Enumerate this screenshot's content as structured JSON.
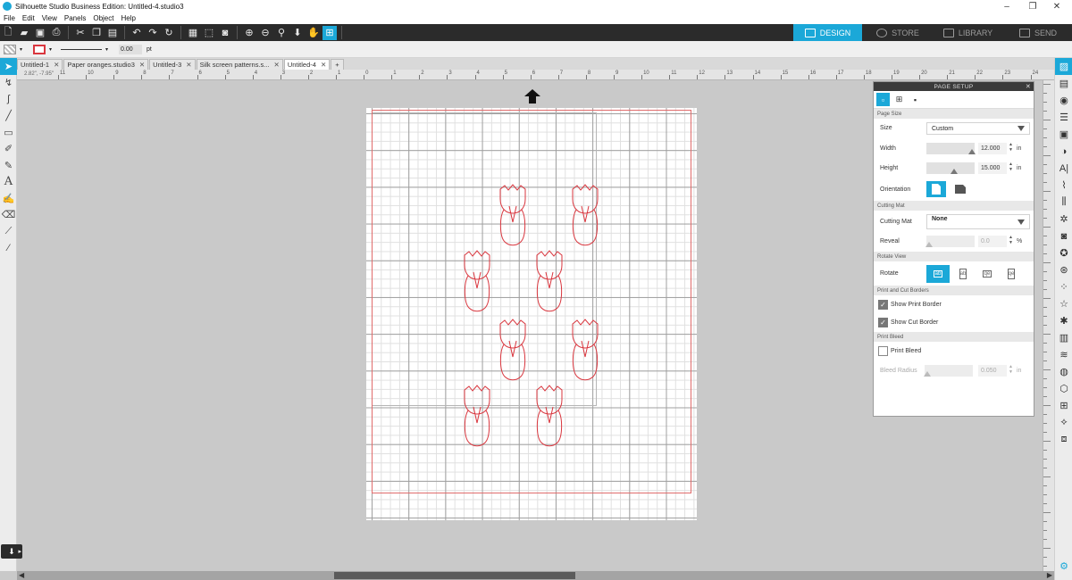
{
  "window": {
    "title": "Silhouette Studio Business Edition: Untitled-4.studio3",
    "minimize": "–",
    "maximize": "❐",
    "close": "✕"
  },
  "menu": [
    "File",
    "Edit",
    "View",
    "Panels",
    "Object",
    "Help"
  ],
  "nav_tabs": {
    "design": "DESIGN",
    "store": "STORE",
    "library": "LIBRARY",
    "send": "SEND"
  },
  "style_bar": {
    "line_width_value": "0.00",
    "line_width_unit": "pt"
  },
  "doc_tabs": [
    {
      "label": "Untitled-1",
      "active": false
    },
    {
      "label": "Paper oranges.studio3",
      "active": false
    },
    {
      "label": "Untitled-3",
      "active": false
    },
    {
      "label": "Silk screen patterns.s...",
      "active": false
    },
    {
      "label": "Untitled-4",
      "active": true
    }
  ],
  "add_tab": "+",
  "ruler": {
    "coord": "2.82\", -7.95\"",
    "labels": [
      "11",
      "10",
      "9",
      "8",
      "7",
      "6",
      "5",
      "4",
      "3",
      "2",
      "1",
      "0",
      "1",
      "2",
      "3",
      "4",
      "5",
      "6",
      "7",
      "8",
      "9",
      "10",
      "11",
      "12",
      "13",
      "14",
      "15",
      "16",
      "17",
      "18",
      "19",
      "20",
      "21",
      "22",
      "23",
      "24"
    ]
  },
  "page_setup": {
    "title": "PAGE SETUP",
    "sections": {
      "page_size": "Page Size",
      "cutting_mat": "Cutting Mat",
      "rotate_view": "Rotate View",
      "print_cut_borders": "Print and Cut Borders",
      "print_bleed": "Print Bleed"
    },
    "size_label": "Size",
    "size_value": "Custom",
    "width_label": "Width",
    "width_value": "12.000",
    "width_unit": "in",
    "height_label": "Height",
    "height_value": "15.000",
    "height_unit": "in",
    "orientation_label": "Orientation",
    "cutting_mat_label": "Cutting Mat",
    "cutting_mat_value": "None",
    "reveal_label": "Reveal",
    "reveal_value": "0.0",
    "reveal_unit": "%",
    "rotate_label": "Rotate",
    "show_print_border_label": "Show Print Border",
    "show_print_border_checked": true,
    "show_cut_border_label": "Show Cut Border",
    "show_cut_border_checked": true,
    "print_bleed_label": "Print Bleed",
    "print_bleed_checked": false,
    "bleed_radius_label": "Bleed Radius",
    "bleed_radius_value": "0.050",
    "bleed_radius_unit": "in"
  },
  "colors": {
    "accent": "#1ba8d8",
    "toolbar_bg": "#2b2b2b",
    "cut_line": "#d9363e"
  }
}
